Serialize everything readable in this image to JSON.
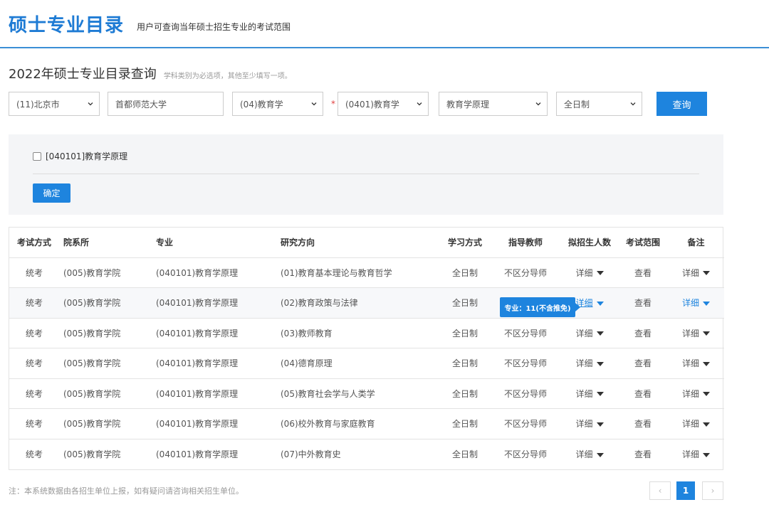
{
  "header": {
    "title": "硕士专业目录",
    "subtitle": "用户可查询当年硕士招生专业的考试范围"
  },
  "query": {
    "title": "2022年硕士专业目录查询",
    "hint": "学科类别为必选项，其他至少填写一项。",
    "province": "(11)北京市",
    "school": "首都师范大学",
    "category": "(04)教育学",
    "required_mark": "*",
    "discipline": "(0401)教育学",
    "major": "教育学原理",
    "study_mode": "全日制",
    "submit_label": "查询"
  },
  "major_panel": {
    "checkbox_label": "[040101]教育学原理",
    "confirm_label": "确定"
  },
  "table": {
    "headers": {
      "exam_type": "考试方式",
      "department": "院系所",
      "major": "专业",
      "direction": "研究方向",
      "study_mode": "学习方式",
      "advisor": "指导教师",
      "enrollment": "拟招生人数",
      "exam_scope": "考试范围",
      "remarks": "备注"
    },
    "rows": [
      {
        "exam_type": "统考",
        "department": "(005)教育学院",
        "major": "(040101)教育学原理",
        "direction": "(01)教育基本理论与教育哲学",
        "study_mode": "全日制",
        "advisor": "不区分导师",
        "enrollment": "详细",
        "exam_scope": "查看",
        "remarks": "详细"
      },
      {
        "exam_type": "统考",
        "department": "(005)教育学院",
        "major": "(040101)教育学原理",
        "direction": "(02)教育政策与法律",
        "study_mode": "全日制",
        "advisor": "",
        "enrollment": "详细",
        "exam_scope": "查看",
        "remarks": "详细"
      },
      {
        "exam_type": "统考",
        "department": "(005)教育学院",
        "major": "(040101)教育学原理",
        "direction": "(03)教师教育",
        "study_mode": "全日制",
        "advisor": "不区分导师",
        "enrollment": "详细",
        "exam_scope": "查看",
        "remarks": "详细"
      },
      {
        "exam_type": "统考",
        "department": "(005)教育学院",
        "major": "(040101)教育学原理",
        "direction": "(04)德育原理",
        "study_mode": "全日制",
        "advisor": "不区分导师",
        "enrollment": "详细",
        "exam_scope": "查看",
        "remarks": "详细"
      },
      {
        "exam_type": "统考",
        "department": "(005)教育学院",
        "major": "(040101)教育学原理",
        "direction": "(05)教育社会学与人类学",
        "study_mode": "全日制",
        "advisor": "不区分导师",
        "enrollment": "详细",
        "exam_scope": "查看",
        "remarks": "详细"
      },
      {
        "exam_type": "统考",
        "department": "(005)教育学院",
        "major": "(040101)教育学原理",
        "direction": "(06)校外教育与家庭教育",
        "study_mode": "全日制",
        "advisor": "不区分导师",
        "enrollment": "详细",
        "exam_scope": "查看",
        "remarks": "详细"
      },
      {
        "exam_type": "统考",
        "department": "(005)教育学院",
        "major": "(040101)教育学原理",
        "direction": "(07)中外教育史",
        "study_mode": "全日制",
        "advisor": "不区分导师",
        "enrollment": "详细",
        "exam_scope": "查看",
        "remarks": "详细"
      }
    ]
  },
  "tooltip": {
    "text": "专业：11(不含推免)"
  },
  "footer": {
    "note": "注：本系统数据由各招生单位上报，如有疑问请咨询相关招生单位。",
    "prev": "‹",
    "page": "1",
    "next": "›"
  },
  "colors": {
    "accent": "#1e84de",
    "title": "#1e7bd4"
  }
}
